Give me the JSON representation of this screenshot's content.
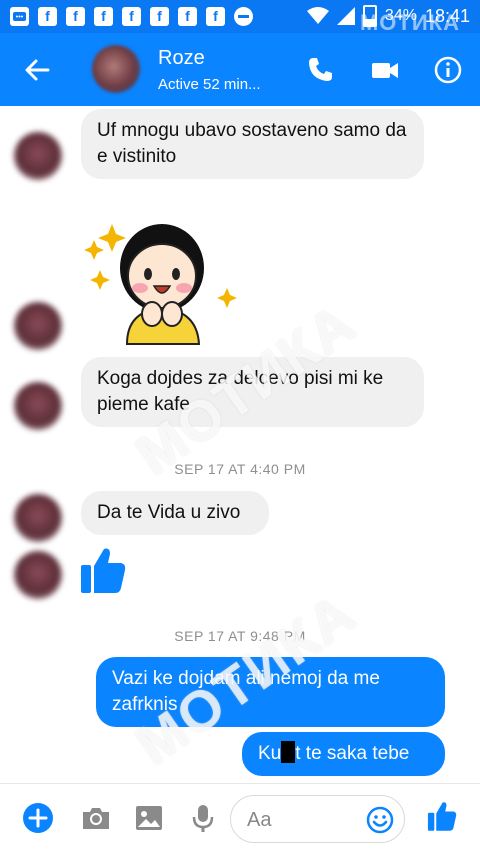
{
  "status_bar": {
    "battery": "34%",
    "time": "18:41",
    "watermark": "МОТИКА"
  },
  "header": {
    "contact_name": "Roze",
    "contact_status": "Active 52 min..."
  },
  "colors": {
    "accent": "#0a84ff",
    "status_bar": "#0a78f2",
    "incoming_bubble": "#f1f0f0"
  },
  "messages": [
    {
      "direction": "in",
      "text": "Uf mnogu ubavo sostaveno samo da e vistinito"
    },
    {
      "direction": "in",
      "type": "sticker",
      "sticker": "girl-cheering-sticker"
    },
    {
      "direction": "in",
      "text": "Koga dojdes za delcevo pisi mi ke pieme kafe"
    },
    {
      "type": "timestamp",
      "text": "SEP 17 AT 4:40 PM"
    },
    {
      "direction": "in",
      "text": "Da te Vida u zivo"
    },
    {
      "direction": "in",
      "type": "like",
      "icon": "thumbs-up-icon"
    },
    {
      "type": "timestamp",
      "text": "SEP 17 AT 9:48 PM"
    },
    {
      "direction": "out",
      "text": "Vazi ke dojdam ali nemoj da me zafrknis"
    },
    {
      "direction": "out",
      "text_before_redaction": "Ku",
      "text_after_redaction": "t te saka tebe"
    }
  ],
  "composer": {
    "placeholder": "Aa"
  },
  "watermark_text": "МОТИКА"
}
